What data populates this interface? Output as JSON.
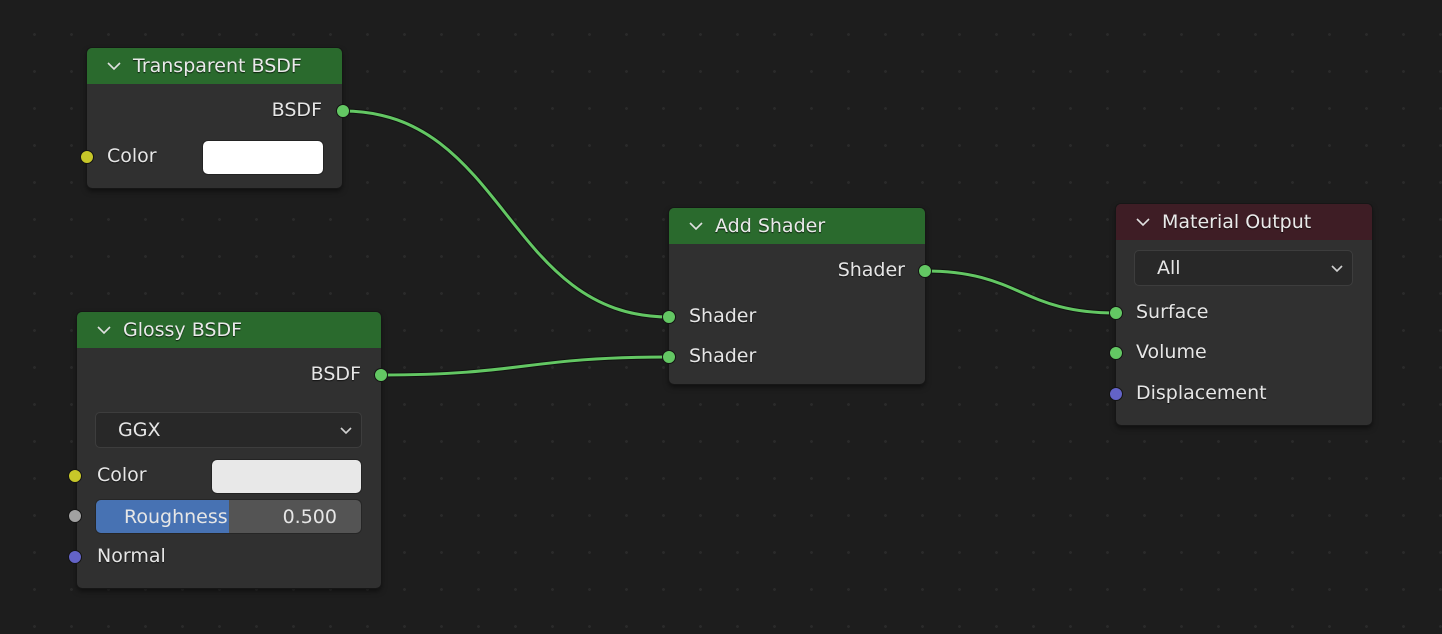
{
  "editor": "Shader Node Editor",
  "colors": {
    "background": "#1d1d1d",
    "node_body": "#303030",
    "shader_header": "#2a6a2d",
    "output_header": "#3e1d25",
    "link": "#63c763",
    "socket_shader": "#63c763",
    "socket_color": "#c7c729",
    "socket_float": "#a1a1a1",
    "socket_vector": "#6363c7",
    "slider_fill": "#4772b3"
  },
  "nodes": {
    "transparent": {
      "title": "Transparent BSDF",
      "outputs": [
        {
          "label": "BSDF",
          "type": "shader"
        }
      ],
      "inputs": [
        {
          "label": "Color",
          "type": "color",
          "value": "#ffffff"
        }
      ]
    },
    "glossy": {
      "title": "Glossy BSDF",
      "outputs": [
        {
          "label": "BSDF",
          "type": "shader"
        }
      ],
      "distribution": "GGX",
      "inputs": [
        {
          "label": "Color",
          "type": "color",
          "value": "#e8e8e8"
        },
        {
          "label": "Roughness",
          "type": "float",
          "value": "0.500",
          "fraction": 0.5
        },
        {
          "label": "Normal",
          "type": "vector"
        }
      ]
    },
    "add_shader": {
      "title": "Add Shader",
      "outputs": [
        {
          "label": "Shader",
          "type": "shader"
        }
      ],
      "inputs": [
        {
          "label": "Shader",
          "type": "shader"
        },
        {
          "label": "Shader",
          "type": "shader"
        }
      ]
    },
    "material_output": {
      "title": "Material Output",
      "target": "All",
      "inputs": [
        {
          "label": "Surface",
          "type": "shader"
        },
        {
          "label": "Volume",
          "type": "shader"
        },
        {
          "label": "Displacement",
          "type": "vector"
        }
      ]
    }
  },
  "links": [
    {
      "from": "Transparent BSDF.BSDF",
      "to": "Add Shader.Shader[0]"
    },
    {
      "from": "Glossy BSDF.BSDF",
      "to": "Add Shader.Shader[1]"
    },
    {
      "from": "Add Shader.Shader",
      "to": "Material Output.Surface"
    }
  ]
}
